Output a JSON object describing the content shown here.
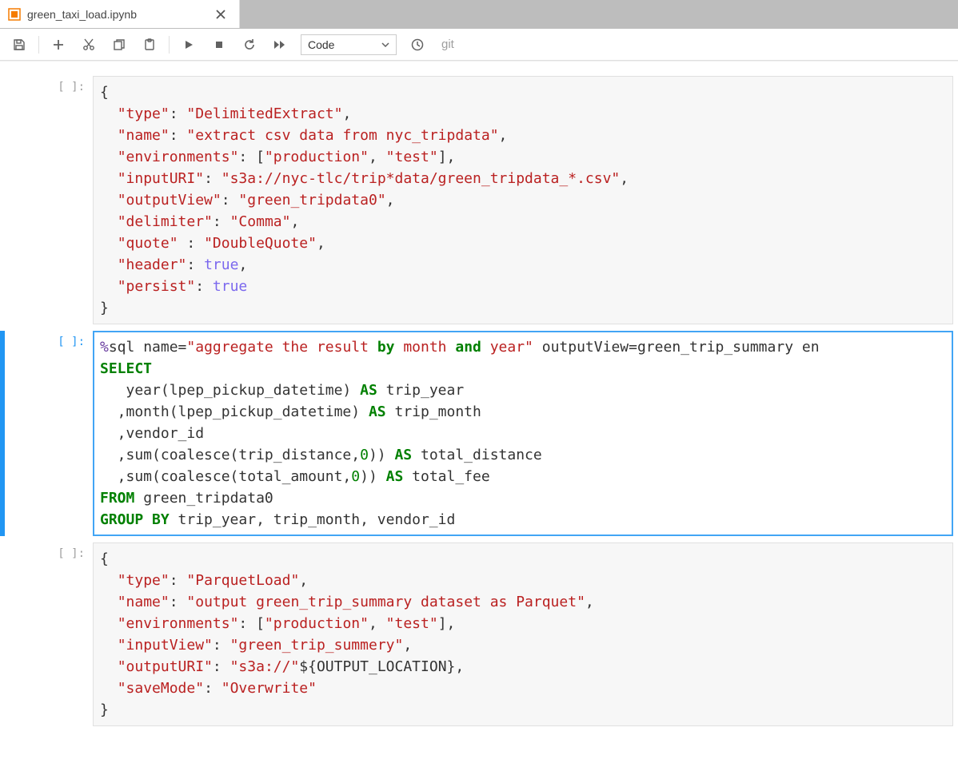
{
  "tab": {
    "title": "green_taxi_load.ipynb"
  },
  "toolbar": {
    "cell_type": "Code",
    "git_label": "git"
  },
  "cells": [
    {
      "prompt": "[ ]:",
      "selected": false,
      "tokens": [
        {
          "t": "{\n",
          "c": "s-punc"
        },
        {
          "t": "  ",
          "c": "s-plain"
        },
        {
          "t": "\"type\"",
          "c": "s-key"
        },
        {
          "t": ": ",
          "c": "s-punc"
        },
        {
          "t": "\"DelimitedExtract\"",
          "c": "s-str"
        },
        {
          "t": ",\n",
          "c": "s-punc"
        },
        {
          "t": "  ",
          "c": "s-plain"
        },
        {
          "t": "\"name\"",
          "c": "s-key"
        },
        {
          "t": ": ",
          "c": "s-punc"
        },
        {
          "t": "\"extract csv data from nyc_tripdata\"",
          "c": "s-str"
        },
        {
          "t": ",\n",
          "c": "s-punc"
        },
        {
          "t": "  ",
          "c": "s-plain"
        },
        {
          "t": "\"environments\"",
          "c": "s-key"
        },
        {
          "t": ": [",
          "c": "s-punc"
        },
        {
          "t": "\"production\"",
          "c": "s-str"
        },
        {
          "t": ", ",
          "c": "s-punc"
        },
        {
          "t": "\"test\"",
          "c": "s-str"
        },
        {
          "t": "],\n",
          "c": "s-punc"
        },
        {
          "t": "  ",
          "c": "s-plain"
        },
        {
          "t": "\"inputURI\"",
          "c": "s-key"
        },
        {
          "t": ": ",
          "c": "s-punc"
        },
        {
          "t": "\"s3a://nyc-tlc/trip*data/green_tripdata_*.csv\"",
          "c": "s-str"
        },
        {
          "t": ",\n",
          "c": "s-punc"
        },
        {
          "t": "  ",
          "c": "s-plain"
        },
        {
          "t": "\"outputView\"",
          "c": "s-key"
        },
        {
          "t": ": ",
          "c": "s-punc"
        },
        {
          "t": "\"green_tripdata0\"",
          "c": "s-str"
        },
        {
          "t": ",\n",
          "c": "s-punc"
        },
        {
          "t": "  ",
          "c": "s-plain"
        },
        {
          "t": "\"delimiter\"",
          "c": "s-key"
        },
        {
          "t": ": ",
          "c": "s-punc"
        },
        {
          "t": "\"Comma\"",
          "c": "s-str"
        },
        {
          "t": ",\n",
          "c": "s-punc"
        },
        {
          "t": "  ",
          "c": "s-plain"
        },
        {
          "t": "\"quote\"",
          "c": "s-key"
        },
        {
          "t": " : ",
          "c": "s-punc"
        },
        {
          "t": "\"DoubleQuote\"",
          "c": "s-str"
        },
        {
          "t": ",\n",
          "c": "s-punc"
        },
        {
          "t": "  ",
          "c": "s-plain"
        },
        {
          "t": "\"header\"",
          "c": "s-key"
        },
        {
          "t": ": ",
          "c": "s-punc"
        },
        {
          "t": "true",
          "c": "s-lit"
        },
        {
          "t": ",\n",
          "c": "s-punc"
        },
        {
          "t": "  ",
          "c": "s-plain"
        },
        {
          "t": "\"persist\"",
          "c": "s-key"
        },
        {
          "t": ": ",
          "c": "s-punc"
        },
        {
          "t": "true",
          "c": "s-lit"
        },
        {
          "t": "\n",
          "c": "s-punc"
        },
        {
          "t": "}",
          "c": "s-punc"
        }
      ]
    },
    {
      "prompt": "[ ]:",
      "selected": true,
      "tokens": [
        {
          "t": "%",
          "c": "s-magic"
        },
        {
          "t": "sql name",
          "c": "s-plain"
        },
        {
          "t": "=",
          "c": "s-punc"
        },
        {
          "t": "\"aggregate the result ",
          "c": "s-str"
        },
        {
          "t": "by",
          "c": "s-kw"
        },
        {
          "t": " month ",
          "c": "s-str"
        },
        {
          "t": "and",
          "c": "s-kw"
        },
        {
          "t": " year\"",
          "c": "s-str"
        },
        {
          "t": " outputView",
          "c": "s-plain"
        },
        {
          "t": "=",
          "c": "s-punc"
        },
        {
          "t": "green_trip_summary en",
          "c": "s-plain"
        },
        {
          "t": "\n",
          "c": "s-plain"
        },
        {
          "t": "SELECT",
          "c": "s-kw"
        },
        {
          "t": "\n",
          "c": "s-plain"
        },
        {
          "t": "   year(lpep_pickup_datetime) ",
          "c": "s-plain"
        },
        {
          "t": "AS",
          "c": "s-kw"
        },
        {
          "t": " trip_year\n",
          "c": "s-plain"
        },
        {
          "t": "  ,month(lpep_pickup_datetime) ",
          "c": "s-plain"
        },
        {
          "t": "AS",
          "c": "s-kw"
        },
        {
          "t": " trip_month\n",
          "c": "s-plain"
        },
        {
          "t": "  ,vendor_id\n",
          "c": "s-plain"
        },
        {
          "t": "  ,sum(coalesce(trip_distance,",
          "c": "s-plain"
        },
        {
          "t": "0",
          "c": "s-num"
        },
        {
          "t": ")) ",
          "c": "s-plain"
        },
        {
          "t": "AS",
          "c": "s-kw"
        },
        {
          "t": " total_distance\n",
          "c": "s-plain"
        },
        {
          "t": "  ,sum(coalesce(total_amount,",
          "c": "s-plain"
        },
        {
          "t": "0",
          "c": "s-num"
        },
        {
          "t": ")) ",
          "c": "s-plain"
        },
        {
          "t": "AS",
          "c": "s-kw"
        },
        {
          "t": " total_fee\n",
          "c": "s-plain"
        },
        {
          "t": "FROM",
          "c": "s-kw"
        },
        {
          "t": " green_tripdata0\n",
          "c": "s-plain"
        },
        {
          "t": "GROUP BY",
          "c": "s-kw"
        },
        {
          "t": " trip_year, trip_month, vendor_id",
          "c": "s-plain"
        }
      ]
    },
    {
      "prompt": "[ ]:",
      "selected": false,
      "tokens": [
        {
          "t": "{\n",
          "c": "s-punc"
        },
        {
          "t": "  ",
          "c": "s-plain"
        },
        {
          "t": "\"type\"",
          "c": "s-key"
        },
        {
          "t": ": ",
          "c": "s-punc"
        },
        {
          "t": "\"ParquetLoad\"",
          "c": "s-str"
        },
        {
          "t": ",\n",
          "c": "s-punc"
        },
        {
          "t": "  ",
          "c": "s-plain"
        },
        {
          "t": "\"name\"",
          "c": "s-key"
        },
        {
          "t": ": ",
          "c": "s-punc"
        },
        {
          "t": "\"output green_trip_summary dataset as Parquet\"",
          "c": "s-str"
        },
        {
          "t": ",\n",
          "c": "s-punc"
        },
        {
          "t": "  ",
          "c": "s-plain"
        },
        {
          "t": "\"environments\"",
          "c": "s-key"
        },
        {
          "t": ": [",
          "c": "s-punc"
        },
        {
          "t": "\"production\"",
          "c": "s-str"
        },
        {
          "t": ", ",
          "c": "s-punc"
        },
        {
          "t": "\"test\"",
          "c": "s-str"
        },
        {
          "t": "],\n",
          "c": "s-punc"
        },
        {
          "t": "  ",
          "c": "s-plain"
        },
        {
          "t": "\"inputView\"",
          "c": "s-key"
        },
        {
          "t": ": ",
          "c": "s-punc"
        },
        {
          "t": "\"green_trip_summery\"",
          "c": "s-str"
        },
        {
          "t": ",\n",
          "c": "s-punc"
        },
        {
          "t": "  ",
          "c": "s-plain"
        },
        {
          "t": "\"outputURI\"",
          "c": "s-key"
        },
        {
          "t": ": ",
          "c": "s-punc"
        },
        {
          "t": "\"s3a://\"",
          "c": "s-str"
        },
        {
          "t": "${OUTPUT_LOCATION},\n",
          "c": "s-plain"
        },
        {
          "t": "  ",
          "c": "s-plain"
        },
        {
          "t": "\"saveMode\"",
          "c": "s-key"
        },
        {
          "t": ": ",
          "c": "s-punc"
        },
        {
          "t": "\"Overwrite\"",
          "c": "s-str"
        },
        {
          "t": "\n",
          "c": "s-punc"
        },
        {
          "t": "}",
          "c": "s-punc"
        }
      ]
    }
  ]
}
